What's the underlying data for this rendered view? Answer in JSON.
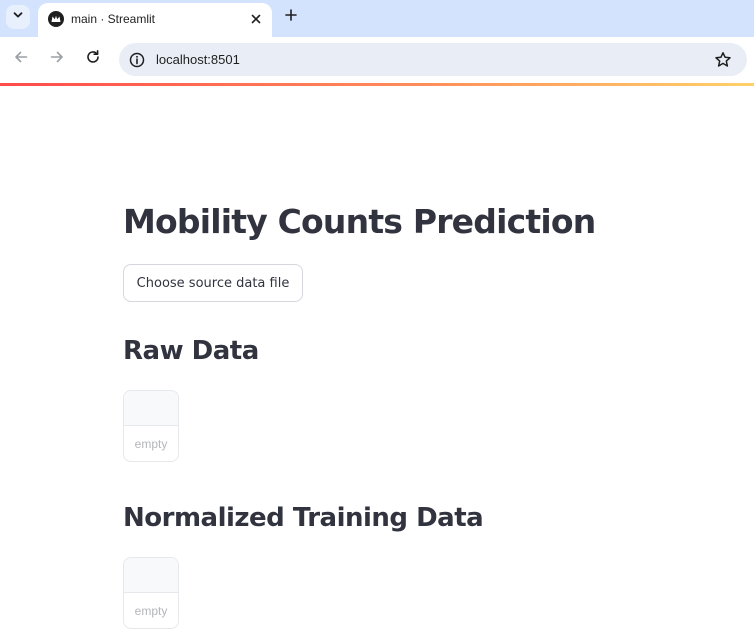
{
  "browser": {
    "tab_title": "main · Streamlit",
    "url": "localhost:8501",
    "icons": {
      "tab_search": "chevron-down-icon",
      "favicon": "streamlit-crown-icon",
      "close": "close-icon",
      "new_tab": "plus-icon",
      "back": "arrow-left-icon",
      "forward": "arrow-right-icon",
      "reload": "reload-icon",
      "site_info": "info-icon",
      "bookmark": "star-icon"
    }
  },
  "app": {
    "title": "Mobility Counts Prediction",
    "upload_button_label": "Choose source data file",
    "sections": [
      {
        "heading": "Raw Data",
        "table_placeholder": "empty"
      },
      {
        "heading": "Normalized Training Data",
        "table_placeholder": "empty"
      }
    ]
  },
  "colors": {
    "tabbar": "#d3e3fd",
    "omnibox": "#e9eef6",
    "text": "#31333f",
    "accent_gradient_start": "#ff4b4b",
    "accent_gradient_end": "#ffd16a"
  }
}
